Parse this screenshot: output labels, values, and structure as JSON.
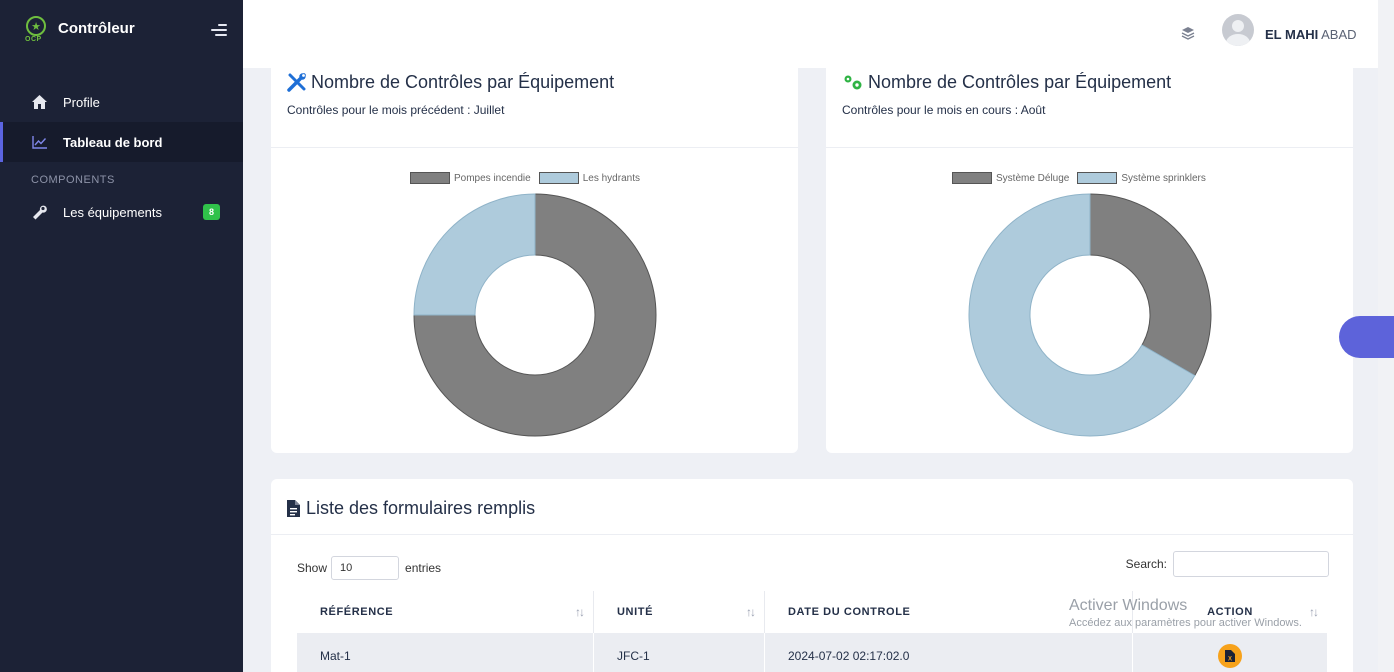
{
  "sidebar": {
    "brand": {
      "logo_text": "OCP",
      "name": "Contrôleur"
    },
    "items": [
      {
        "label": "Profile",
        "icon": "home-icon"
      },
      {
        "label": "Tableau de bord",
        "icon": "chart-line-icon",
        "active": true
      }
    ],
    "section_label": "COMPONENTS",
    "components": [
      {
        "label": "Les équipements",
        "icon": "wrench-icon",
        "badge": "8"
      }
    ]
  },
  "topbar": {
    "icon": "layers-icon",
    "user_first": "EL MAHI",
    "user_last": "ABAD"
  },
  "cards": {
    "left": {
      "title": "Nombre de Contrôles par Équipement",
      "subtitle": "Contrôles pour le mois précédent : Juillet",
      "icon": "tools-icon"
    },
    "right": {
      "title": "Nombre de Contrôles par Équipement",
      "subtitle": "Contrôles pour le mois en cours : Août",
      "icon": "gears-icon"
    }
  },
  "chart_data": [
    {
      "type": "pie",
      "variant": "doughnut",
      "categories": [
        "Pompes incendie",
        "Les hydrants"
      ],
      "values": [
        3,
        1
      ],
      "colors": [
        "#808080",
        "#aecbdc"
      ],
      "legend": "top"
    },
    {
      "type": "pie",
      "variant": "doughnut",
      "categories": [
        "Système Déluge",
        "Système sprinklers"
      ],
      "values": [
        1,
        2
      ],
      "colors": [
        "#808080",
        "#aecbdc"
      ],
      "legend": "top"
    }
  ],
  "table": {
    "title": "Liste des formulaires remplis",
    "icon": "file-icon",
    "show_label": "Show",
    "entries_value": "10",
    "entries_label": "entries",
    "search_label": "Search:",
    "columns": [
      "RÉFÉRENCE",
      "UNITÉ",
      "DATE DU CONTROLE",
      "ACTION"
    ],
    "sort_glyph": "↑↓",
    "rows": [
      {
        "reference": "Mat-1",
        "unite": "JFC-1",
        "date": "2024-07-02 02:17:02.0",
        "action_icon": "pdf-file-icon"
      }
    ]
  },
  "watermark": {
    "line1": "Activer Windows",
    "line2": "Accédez aux paramètres pour activer Windows."
  },
  "colors": {
    "sidebar_bg": "#1c2236",
    "accent": "#5d63da",
    "badge": "#30c24a",
    "action": "#f7a21b",
    "title_icon_blue": "#1f6fd6",
    "title_icon_green": "#2fb344"
  }
}
